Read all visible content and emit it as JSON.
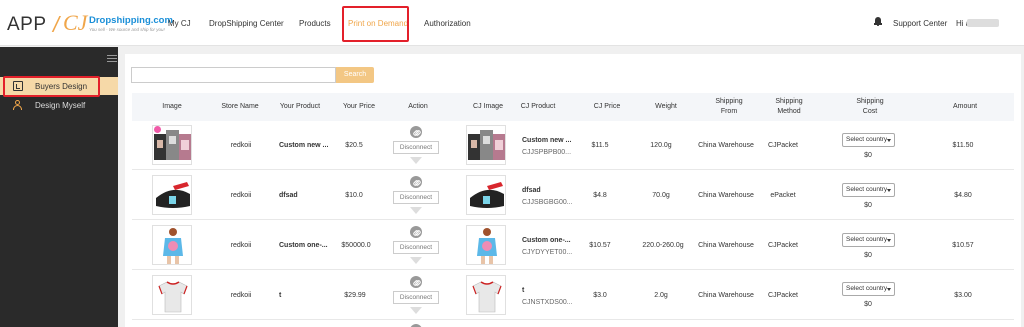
{
  "header": {
    "logo": {
      "app": "APP",
      "slash": "/",
      "cj": "CJ",
      "brand": "Dropshipping.com",
      "tagline": "You sell - We source and ship for you!"
    },
    "nav": [
      {
        "label": "My CJ",
        "active": false
      },
      {
        "label": "DropShipping Center",
        "active": false
      },
      {
        "label": "Products",
        "active": false
      },
      {
        "label": "Print on Demand",
        "active": true
      },
      {
        "label": "Authorization",
        "active": false
      }
    ],
    "support_label": "Support Center",
    "greeting": "Hi a",
    "icons": {
      "notifications": "bell-icon"
    }
  },
  "sidebar": {
    "items": [
      {
        "label": "Buyers Design",
        "icon": "design-doc-icon",
        "active": true
      },
      {
        "label": "Design Myself",
        "icon": "user-design-icon",
        "active": false
      }
    ]
  },
  "search": {
    "placeholder": "",
    "button_label": "Search"
  },
  "table": {
    "headers": [
      "Image",
      "Store Name",
      "Your Product",
      "Your Price",
      "Action",
      "CJ Image",
      "CJ Product",
      "CJ Price",
      "Weight",
      "Shipping\nFrom",
      "Shipping\nMethod",
      "Shipping\nCost",
      "Amount"
    ],
    "action_label": "Disconnect",
    "select_label": "Select country",
    "rows": [
      {
        "store": "redkoii",
        "product": "Custom new ...",
        "price": "$20.5",
        "cj_product": "Custom new ...",
        "cj_sku": "CJJSPBPB00...",
        "cj_price": "$11.5",
        "weight": "120.0g",
        "from": "China Warehouse",
        "method": "CJPacket",
        "cost": "$0",
        "amount": "$11.50",
        "image": "collage-phone-case"
      },
      {
        "store": "redkoii",
        "product": "dfsad",
        "price": "$10.0",
        "cj_product": "dfsad",
        "cj_sku": "CJJSBGBG00...",
        "cj_price": "$4.8",
        "weight": "70.0g",
        "from": "China Warehouse",
        "method": "ePacket",
        "cost": "$0",
        "amount": "$4.80",
        "image": "black-pouch"
      },
      {
        "store": "redkoii",
        "product": "Custom one-...",
        "price": "$50000.0",
        "cj_product": "Custom one-...",
        "cj_sku": "CJYDYYET00...",
        "cj_price": "$10.57",
        "weight": "220.0-260.0g",
        "from": "China Warehouse",
        "method": "CJPacket",
        "cost": "$0",
        "amount": "$10.57",
        "image": "swimsuit"
      },
      {
        "store": "redkoii",
        "product": "t",
        "price": "$29.99",
        "cj_product": "t",
        "cj_sku": "CJNSTXDS00...",
        "cj_price": "$3.0",
        "weight": "2.0g",
        "from": "China Warehouse",
        "method": "CJPacket",
        "cost": "$0",
        "amount": "$3.00",
        "image": "white-tshirt"
      }
    ]
  }
}
